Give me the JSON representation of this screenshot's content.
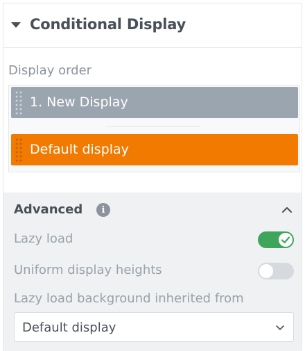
{
  "header": {
    "title": "Conditional Display"
  },
  "display_order": {
    "label": "Display order",
    "items": [
      {
        "label": "1. New Display"
      },
      {
        "label": "Default display"
      }
    ]
  },
  "advanced": {
    "title": "Advanced",
    "info_icon": "i",
    "lazy_load": {
      "label": "Lazy load",
      "enabled": true
    },
    "uniform_heights": {
      "label": "Uniform display heights",
      "enabled": false
    },
    "lazy_bg": {
      "label": "Lazy load background inherited from",
      "selected": "Default display"
    }
  },
  "colors": {
    "new_display_bg": "#9ba5af",
    "default_display_bg": "#f27a00",
    "toggle_on": "#3ea55a",
    "toggle_off": "#d6dadf"
  }
}
